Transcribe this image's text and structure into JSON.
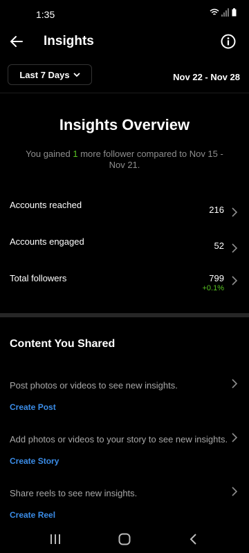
{
  "status_bar": {
    "time": "1:35",
    "icons": [
      "wifi-icon",
      "signal-icon",
      "battery-icon"
    ]
  },
  "header": {
    "title": "Insights",
    "back_icon": "arrow-left-icon",
    "info_icon": "info-circle-icon"
  },
  "filter": {
    "range_label": "Last 7 Days",
    "date_range": "Nov 22 - Nov 28"
  },
  "overview": {
    "title": "Insights Overview",
    "subtitle_prefix": "You gained ",
    "subtitle_highlight": "1",
    "subtitle_suffix": " more follower compared to Nov 15 - Nov 21.",
    "metrics": [
      {
        "label": "Accounts reached",
        "value": "216",
        "delta": ""
      },
      {
        "label": "Accounts engaged",
        "value": "52",
        "delta": ""
      },
      {
        "label": "Total followers",
        "value": "799",
        "delta": "+0.1%"
      }
    ]
  },
  "content_shared": {
    "title": "Content You Shared",
    "items": [
      {
        "text": "Post photos or videos to see new insights.",
        "link": "Create Post"
      },
      {
        "text": "Add photos or videos to your story to see new insights.",
        "link": "Create Story"
      },
      {
        "text": "Share reels to see new insights.",
        "link": "Create Reel"
      }
    ]
  },
  "colors": {
    "background": "#000000",
    "accent_link": "#3b8de8",
    "positive": "#58c322",
    "muted_text": "#8e8e8e"
  },
  "nav_bar": {
    "icons": [
      "recent-apps-icon",
      "home-icon",
      "back-icon"
    ]
  }
}
